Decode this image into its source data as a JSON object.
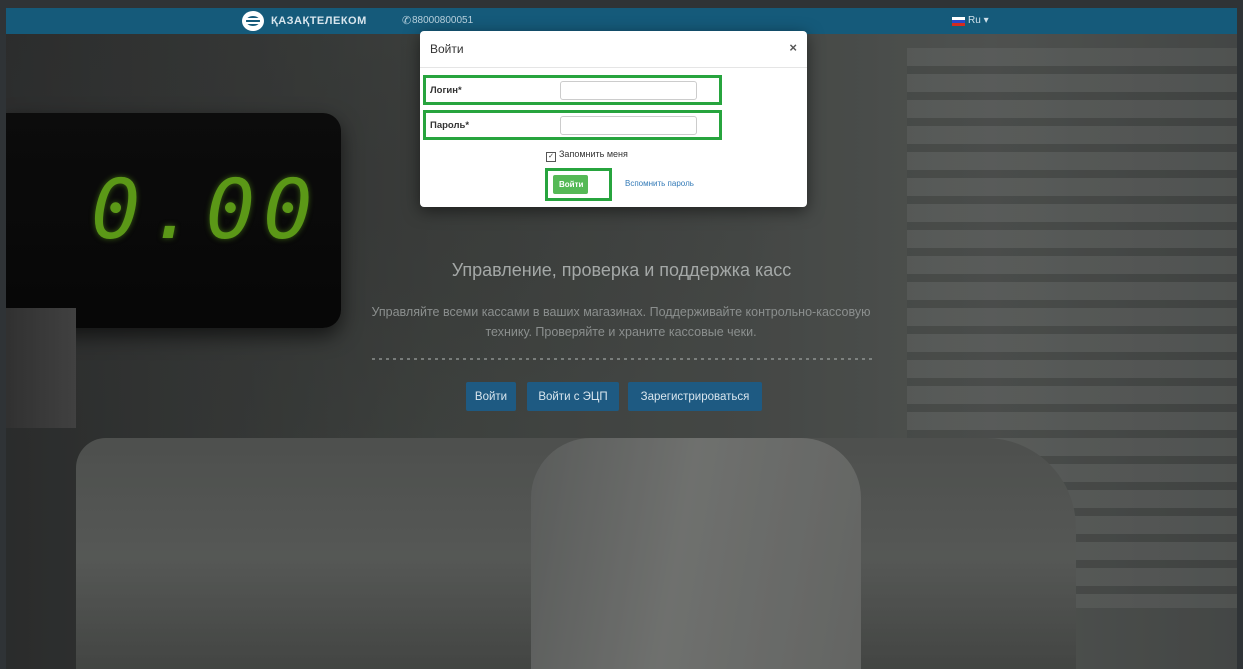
{
  "topbar": {
    "logo_icon": "kazakhtelecom-logo-icon",
    "brand": "ҚАЗАҚТЕЛЕКОМ",
    "phone_icon": "phone-icon",
    "phone": "88000800051",
    "language": "Ru",
    "language_caret": "▾",
    "colors": {
      "bar": "#155a7a"
    }
  },
  "display": {
    "digits": "0.00"
  },
  "hero": {
    "title": "Управление, проверка и поддержка касс",
    "subtitle": "Управляйте всеми кассами в ваших магазинах. Поддерживайте контрольно-кассовую технику. Проверяйте и храните кассовые чеки.",
    "buttons": {
      "login": "Войти",
      "login_ecp": "Войти с ЭЦП",
      "register": "Зарегистрироваться"
    },
    "colors": {
      "button": "#1e5a82"
    }
  },
  "modal": {
    "title": "Войти",
    "close": "×",
    "login_label": "Логин*",
    "login_value": "",
    "password_label": "Пароль*",
    "password_value": "",
    "remember_label": "Запомнить меня",
    "remember_checked": true,
    "submit": "Войти",
    "forgot": "Вспомнить пароль",
    "colors": {
      "highlight": "#27a43e",
      "submit": "#55b956",
      "link": "#337ab7"
    }
  }
}
